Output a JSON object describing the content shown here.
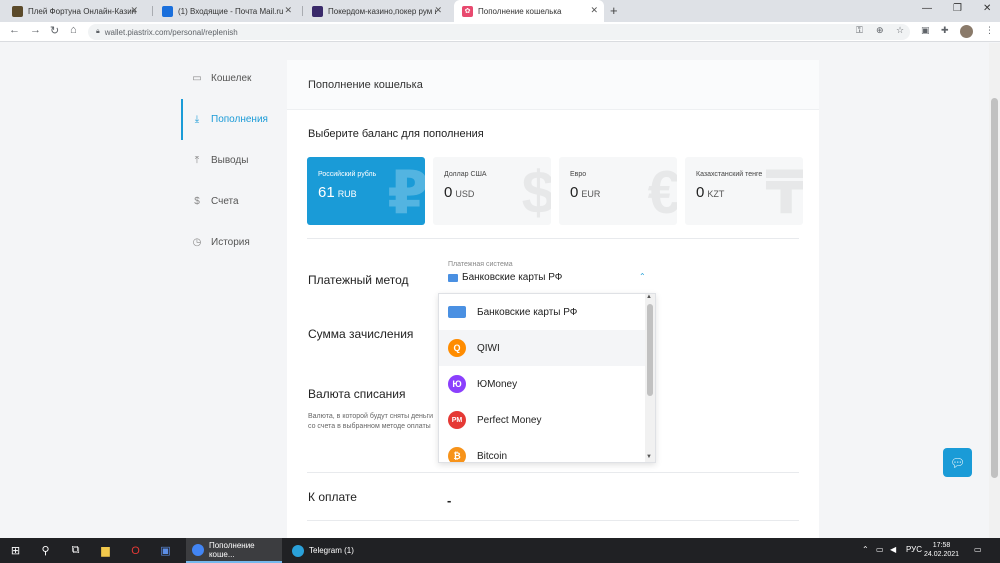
{
  "browser": {
    "tabs": [
      {
        "label": "Плей Фортуна Онлайн-Казино",
        "fav_color": "#5b4a2a"
      },
      {
        "label": "(1) Входящие - Почта Mail.ru",
        "fav_color": "#1a6fdc"
      },
      {
        "label": "Покердом-казино,покер рум и",
        "fav_color": "#3a2a6a"
      },
      {
        "label": "Пополнение кошелька",
        "fav_color": "#e84a6f"
      }
    ],
    "new_tab": "+",
    "url": "wallet.piastrix.com/personal/replenish"
  },
  "sidebar": {
    "items": [
      {
        "label": "Кошелек",
        "icon": "wallet-icon",
        "glyph": "▭"
      },
      {
        "label": "Пополнения",
        "icon": "download-icon",
        "glyph": "⤓"
      },
      {
        "label": "Выводы",
        "icon": "upload-icon",
        "glyph": "⤒"
      },
      {
        "label": "Счета",
        "icon": "invoice-icon",
        "glyph": "$"
      },
      {
        "label": "История",
        "icon": "history-icon",
        "glyph": "◷"
      }
    ]
  },
  "card": {
    "title": "Пополнение кошелька",
    "choose_balance": "Выберите баланс для пополнения"
  },
  "balances": [
    {
      "name": "Российский рубль",
      "amount": "61",
      "currency": "RUB",
      "symbol": "₽"
    },
    {
      "name": "Доллар США",
      "amount": "0",
      "currency": "USD",
      "symbol": "$"
    },
    {
      "name": "Евро",
      "amount": "0",
      "currency": "EUR",
      "symbol": "€"
    },
    {
      "name": "Казахстанский тенге",
      "amount": "0",
      "currency": "KZT",
      "symbol": "₸"
    }
  ],
  "form": {
    "payment_method_label": "Платежный метод",
    "select_caption": "Платежная система",
    "selected_system": "Банковские карты РФ",
    "amount_label": "Сумма зачисления",
    "currency_label": "Валюта списания",
    "currency_hint": "Валюта, в которой будут сняты деньги со счета в выбранном методе оплаты",
    "to_pay_label": "К оплате",
    "to_pay_value": "-"
  },
  "dropdown": {
    "options": [
      {
        "label": "Банковские карты РФ",
        "icon": "bank-card-icon",
        "glyph": "▬",
        "color": "#4a90e2"
      },
      {
        "label": "QIWI",
        "icon": "qiwi-icon",
        "glyph": "Q",
        "color": "#ff8c00"
      },
      {
        "label": "ЮMoney",
        "icon": "yoomoney-icon",
        "glyph": "Ю",
        "color": "#8b3ffd"
      },
      {
        "label": "Perfect Money",
        "icon": "perfect-money-icon",
        "glyph": "PM",
        "color": "#e53935"
      },
      {
        "label": "Bitcoin",
        "icon": "bitcoin-icon",
        "glyph": "₿",
        "color": "#f7931a"
      }
    ],
    "hovered_index": 1
  },
  "taskbar": {
    "apps": [
      {
        "label": "Пополнение коше...",
        "color": "#4285f4"
      },
      {
        "label": "Telegram (1)",
        "color": "#2aa1da"
      }
    ],
    "language": "РУС",
    "time": "17:58",
    "date": "24.02.2021"
  }
}
